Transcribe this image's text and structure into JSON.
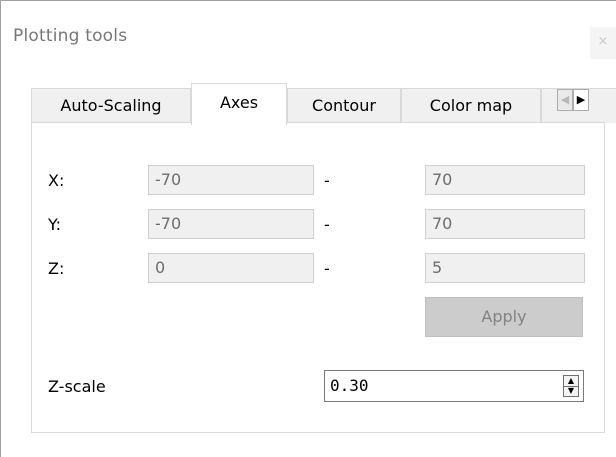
{
  "window": {
    "title": "Plotting tools",
    "close_glyph": "×"
  },
  "tabs": [
    {
      "label": "Auto-Scaling",
      "active": false
    },
    {
      "label": "Axes",
      "active": true
    },
    {
      "label": "Contour",
      "active": false
    },
    {
      "label": "Color map",
      "active": false
    }
  ],
  "tab_scroller": {
    "left_icon": "◀",
    "right_icon": "▶"
  },
  "axes": {
    "rows": [
      {
        "label": "X:",
        "min": "-70",
        "separator": "-",
        "max": "70"
      },
      {
        "label": "Y:",
        "min": "-70",
        "separator": "-",
        "max": "70"
      },
      {
        "label": "Z:",
        "min": "0",
        "separator": "-",
        "max": "5"
      }
    ],
    "apply_label": "Apply"
  },
  "zscale": {
    "label": "Z-scale",
    "value": "0.30",
    "up_icon": "▲",
    "down_icon": "▼"
  },
  "colors": {
    "disabled_field_bg": "#f0f0f0",
    "disabled_text": "#6d6d6d",
    "apply_bg": "#cccccc"
  }
}
